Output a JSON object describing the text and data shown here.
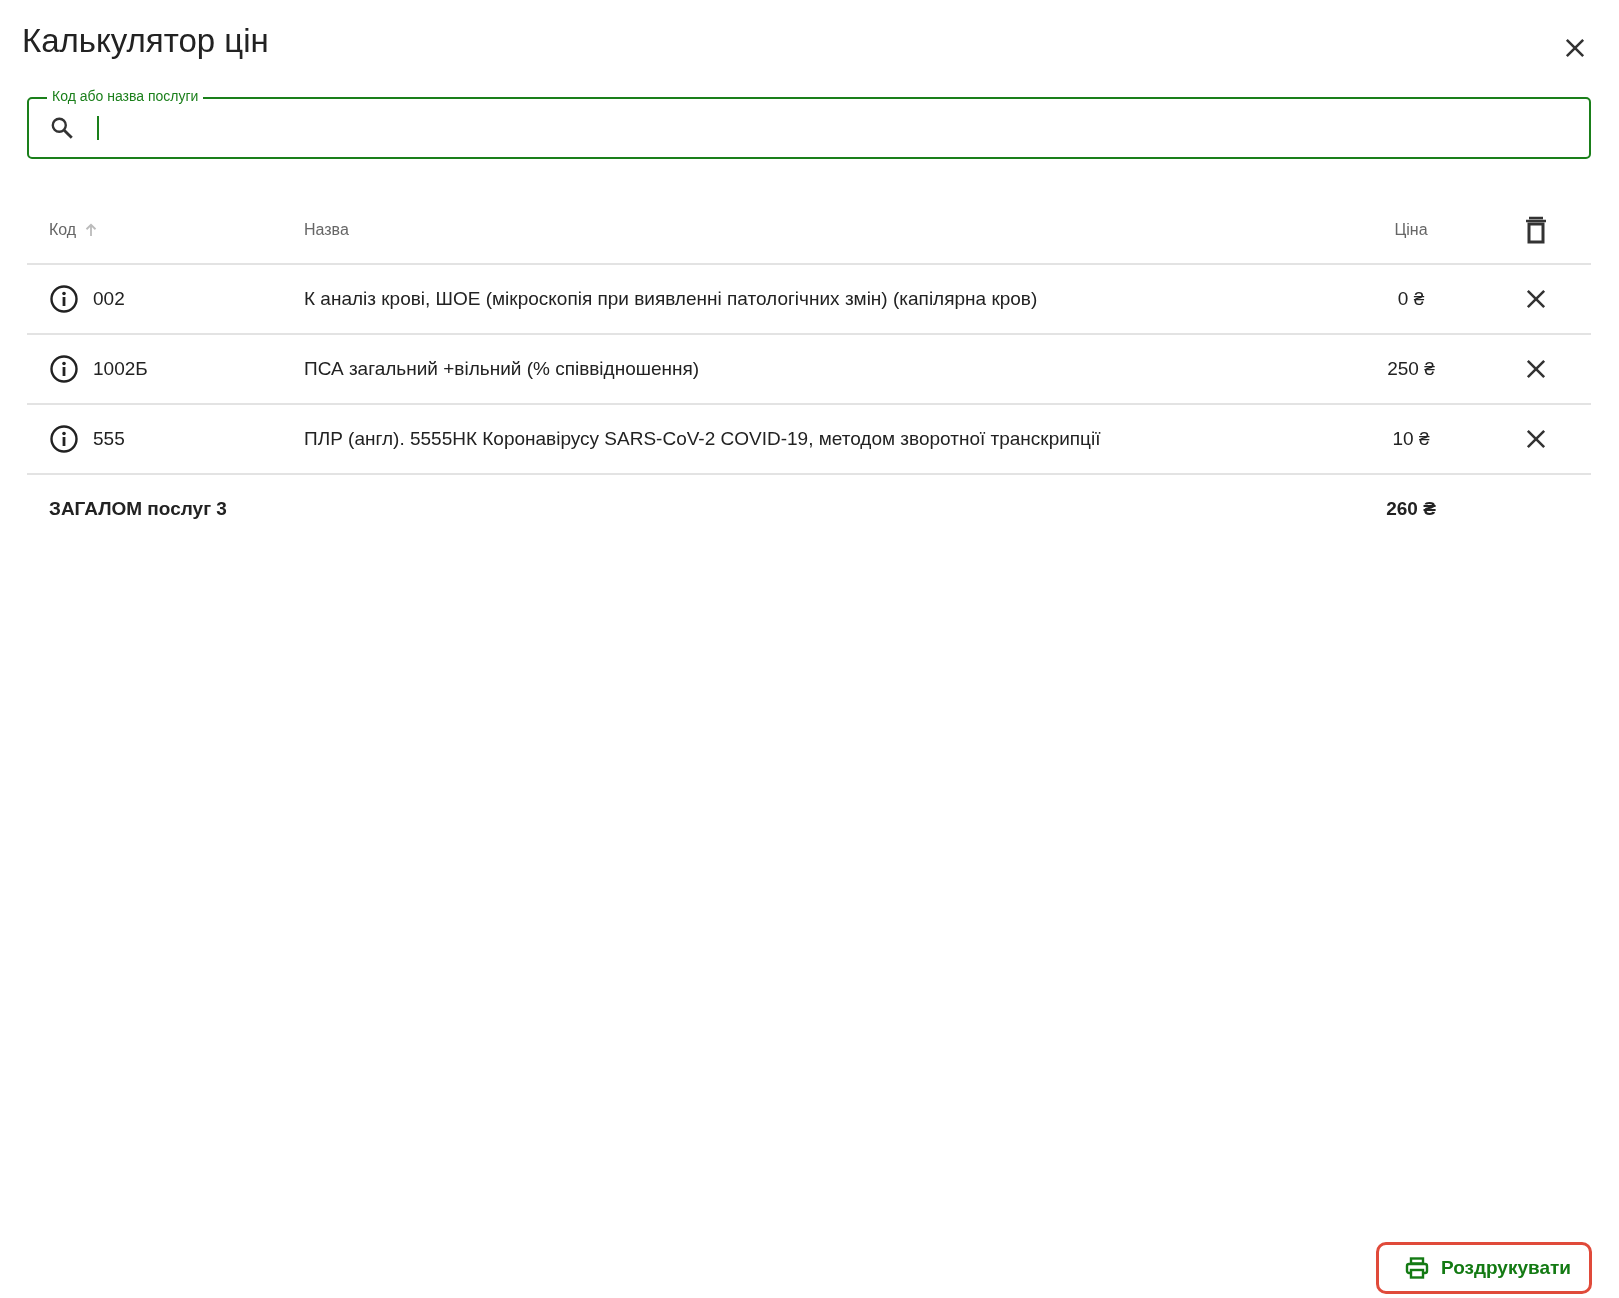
{
  "dialog": {
    "title": "Калькулятор цін"
  },
  "search": {
    "label": "Код або назва послуги",
    "focused": true
  },
  "table": {
    "columns": [
      {
        "label": "Код",
        "sorted": true
      },
      {
        "label": "Назва",
        "sorted": false
      },
      {
        "label": "Ціна",
        "sorted": false
      }
    ],
    "rows": [
      {
        "code": "002",
        "name": "К аналіз крові, ШОЕ (мікроскопія при виявленні патологічних змін) (капілярна кров)",
        "price": "0 ₴"
      },
      {
        "code": "1002Б",
        "name": "ПСА загальний +вільний (% співвідношення)",
        "price": "250 ₴"
      },
      {
        "code": "555",
        "name": "ПЛР (англ). 5555НК Коронавірусу SARS-CoV-2 COVID-19, методом зворотної транскрипції",
        "price": "10 ₴"
      }
    ],
    "total": {
      "label": "ЗАГАЛОМ послуг 3",
      "price": "260 ₴"
    }
  },
  "print_button": {
    "label": "Роздрукувати"
  }
}
